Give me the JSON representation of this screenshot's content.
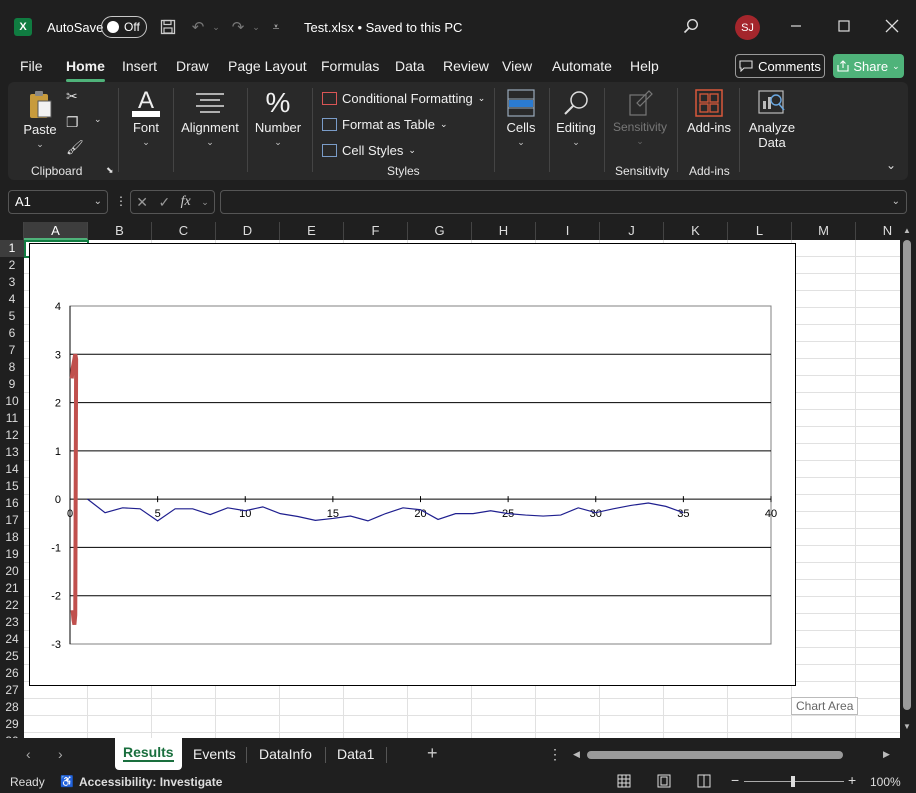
{
  "titlebar": {
    "app_icon": "excel-icon",
    "autosave_label": "AutoSave",
    "autosave_state": "Off",
    "document_title": "Test.xlsx • Saved to this PC",
    "user_initials": "SJ"
  },
  "menu": {
    "items": [
      "File",
      "Home",
      "Insert",
      "Draw",
      "Page Layout",
      "Formulas",
      "Data",
      "Review",
      "View",
      "Automate",
      "Help"
    ],
    "active": "Home",
    "comments_label": "Comments",
    "share_label": "Share"
  },
  "ribbon": {
    "paste_label": "Paste",
    "clipboard_label": "Clipboard",
    "font_label": "Font",
    "alignment_label": "Alignment",
    "number_label": "Number",
    "conditional_formatting_label": "Conditional Formatting",
    "format_as_table_label": "Format as Table",
    "cell_styles_label": "Cell Styles",
    "styles_label": "Styles",
    "cells_label": "Cells",
    "editing_label": "Editing",
    "sensitivity_button_label": "Sensitivity",
    "sensitivity_group_label": "Sensitivity",
    "addins_button_label": "Add-ins",
    "addins_group_label": "Add-ins",
    "analyze_data_line1": "Analyze",
    "analyze_data_line2": "Data"
  },
  "formula_bar": {
    "name_box": "A1",
    "fx_label": "fx",
    "formula_value": ""
  },
  "grid": {
    "columns": [
      "A",
      "B",
      "C",
      "D",
      "E",
      "F",
      "G",
      "H",
      "I",
      "J",
      "K",
      "L",
      "M",
      "N"
    ],
    "rows": [
      "1",
      "2",
      "3",
      "4",
      "5",
      "6",
      "7",
      "8",
      "9",
      "10",
      "11",
      "12",
      "13",
      "14",
      "15",
      "16",
      "17",
      "18",
      "19",
      "20",
      "21",
      "22",
      "23",
      "24",
      "25",
      "26",
      "27",
      "28",
      "29",
      "30"
    ],
    "selected_cell": "A1"
  },
  "chart_tooltip": "Chart Area",
  "chart_data": {
    "type": "line",
    "xlim": [
      0,
      40
    ],
    "ylim": [
      -3,
      4
    ],
    "x_ticks": [
      "0",
      "5",
      "10",
      "15",
      "20",
      "25",
      "30",
      "35",
      "40"
    ],
    "y_ticks": [
      "4",
      "3",
      "2",
      "1",
      "0",
      "-1",
      "-2",
      "-3"
    ],
    "grid": "horizontal",
    "series": [
      {
        "color": "#1f1f8f",
        "x": [
          1,
          2,
          3,
          4,
          5,
          6,
          7,
          8,
          9,
          10,
          11,
          12,
          13,
          14,
          15,
          16,
          17,
          18,
          19,
          20,
          21,
          22,
          23,
          24,
          25,
          26,
          27,
          28,
          29,
          30,
          31,
          32,
          33,
          34,
          35
        ],
        "y": [
          0.0,
          -0.28,
          -0.18,
          -0.2,
          -0.45,
          -0.2,
          -0.2,
          -0.32,
          -0.18,
          -0.24,
          -0.16,
          -0.3,
          -0.36,
          -0.44,
          -0.4,
          -0.35,
          -0.45,
          -0.3,
          -0.18,
          -0.22,
          -0.42,
          -0.3,
          -0.3,
          -0.24,
          -0.3,
          -0.33,
          -0.35,
          -0.33,
          -0.18,
          -0.28,
          -0.2,
          -0.13,
          -0.08,
          -0.15,
          -0.28
        ]
      },
      {
        "color": "#c0504d",
        "x": [
          0.1,
          0.15,
          0.2,
          0.25,
          0.3,
          0.35,
          0.3,
          0.25,
          0.2,
          0.15
        ],
        "y": [
          2.5,
          2.7,
          2.8,
          2.9,
          3.0,
          2.9,
          -2.4,
          -2.6,
          -2.5,
          -2.3
        ]
      }
    ]
  },
  "sheets": {
    "tabs": [
      "Results",
      "Events",
      "DataInfo",
      "Data1"
    ],
    "active": "Results"
  },
  "status": {
    "ready": "Ready",
    "accessibility": "Accessibility: Investigate",
    "zoom": "100%"
  }
}
